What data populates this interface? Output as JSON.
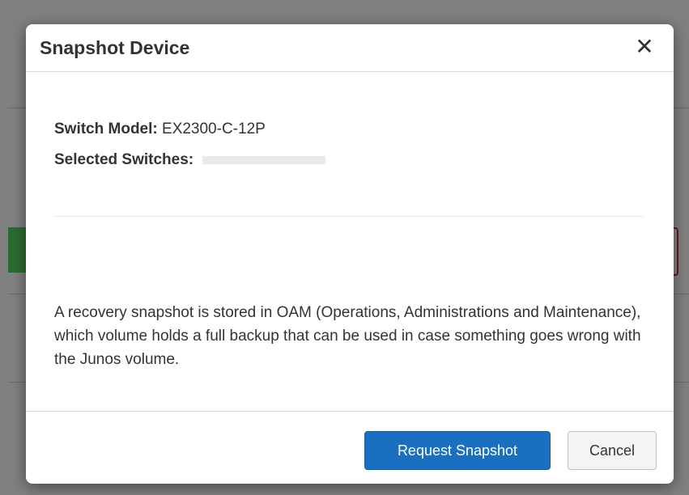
{
  "modal": {
    "title": "Snapshot Device",
    "close_glyph": "✕",
    "switch_model_label": "Switch Model:",
    "switch_model_value": "EX2300-C-12P",
    "selected_switches_label": "Selected Switches:",
    "description": "A recovery snapshot is stored in OAM (Operations, Administrations and Maintenance), which volume holds a full backup that can be used in case something goes wrong with the Junos volume.",
    "primary_button": "Request Snapshot",
    "secondary_button": "Cancel"
  },
  "colors": {
    "primary_button": "#1a6fc0",
    "overlay": "#808080"
  },
  "icons": {
    "close": "close-icon"
  }
}
